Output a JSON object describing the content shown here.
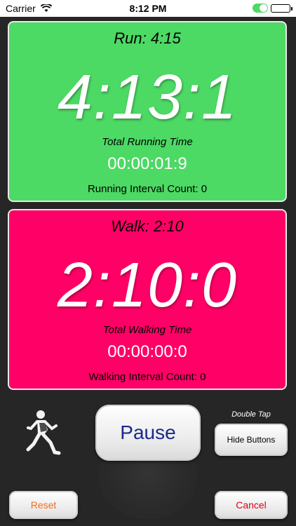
{
  "status_bar": {
    "carrier": "Carrier",
    "time": "8:12 PM",
    "wifi_icon": "wifi-icon",
    "toggle_icon": "toggle-icon",
    "battery_icon": "battery-icon"
  },
  "run": {
    "interval_title": "Run:  4:15",
    "current_time": "4:13:1",
    "total_label": "Total Running Time",
    "total_time": "00:00:01:9",
    "count_label": "Running Interval Count: 0",
    "color": "#4cd964"
  },
  "walk": {
    "interval_title": "Walk:  2:10",
    "current_time": "2:10:0",
    "total_label": "Total Walking Time",
    "total_time": "00:00:00:0",
    "count_label": "Walking Interval Count: 0",
    "color": "#ff0066"
  },
  "controls": {
    "runner_icon": "runner-icon",
    "pause_label": "Pause",
    "double_tap_label": "Double Tap",
    "hide_buttons_label": "Hide Buttons",
    "reset_label": "Reset",
    "cancel_label": "Cancel"
  }
}
